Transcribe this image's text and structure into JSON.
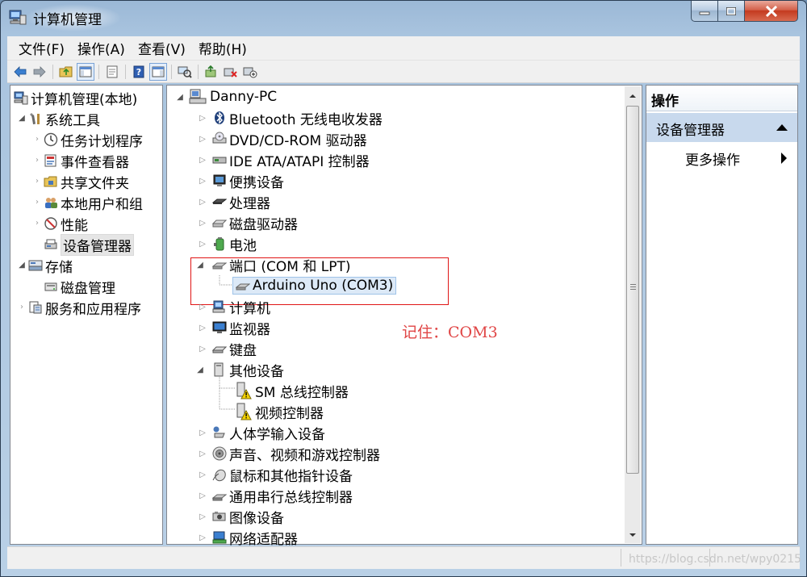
{
  "window": {
    "title": "计算机管理"
  },
  "menu": [
    "文件(F)",
    "操作(A)",
    "查看(V)",
    "帮助(H)"
  ],
  "left_tree": {
    "root": "计算机管理(本地)",
    "system_tools": "系统工具",
    "task_scheduler": "任务计划程序",
    "event_viewer": "事件查看器",
    "shared_folders": "共享文件夹",
    "local_users": "本地用户和组",
    "performance": "性能",
    "device_manager": "设备管理器",
    "storage": "存储",
    "disk_management": "磁盘管理",
    "services_apps": "服务和应用程序"
  },
  "device_tree": {
    "computer": "Danny-PC",
    "bluetooth": "Bluetooth 无线电收发器",
    "dvd": "DVD/CD-ROM 驱动器",
    "ide": "IDE ATA/ATAPI 控制器",
    "portable": "便携设备",
    "processor": "处理器",
    "disk_drives": "磁盘驱动器",
    "battery": "电池",
    "ports": "端口 (COM 和 LPT)",
    "arduino": "Arduino Uno (COM3)",
    "computer_node": "计算机",
    "monitors": "监视器",
    "keyboard": "键盘",
    "other_devices": "其他设备",
    "sm_bus": "SM 总线控制器",
    "video_ctrl": "视频控制器",
    "hid": "人体学输入设备",
    "sound": "声音、视频和游戏控制器",
    "mouse": "鼠标和其他指针设备",
    "usb": "通用串行总线控制器",
    "imaging": "图像设备",
    "network": "网络适配器"
  },
  "annotation": "记住：COM3",
  "actions": {
    "header": "操作",
    "section": "设备管理器",
    "more": "更多操作"
  },
  "watermark": "https://blog.csdn.net/wpy0215",
  "colors": {
    "annotation_red": "#e01515",
    "selection": "#dce9f7"
  }
}
